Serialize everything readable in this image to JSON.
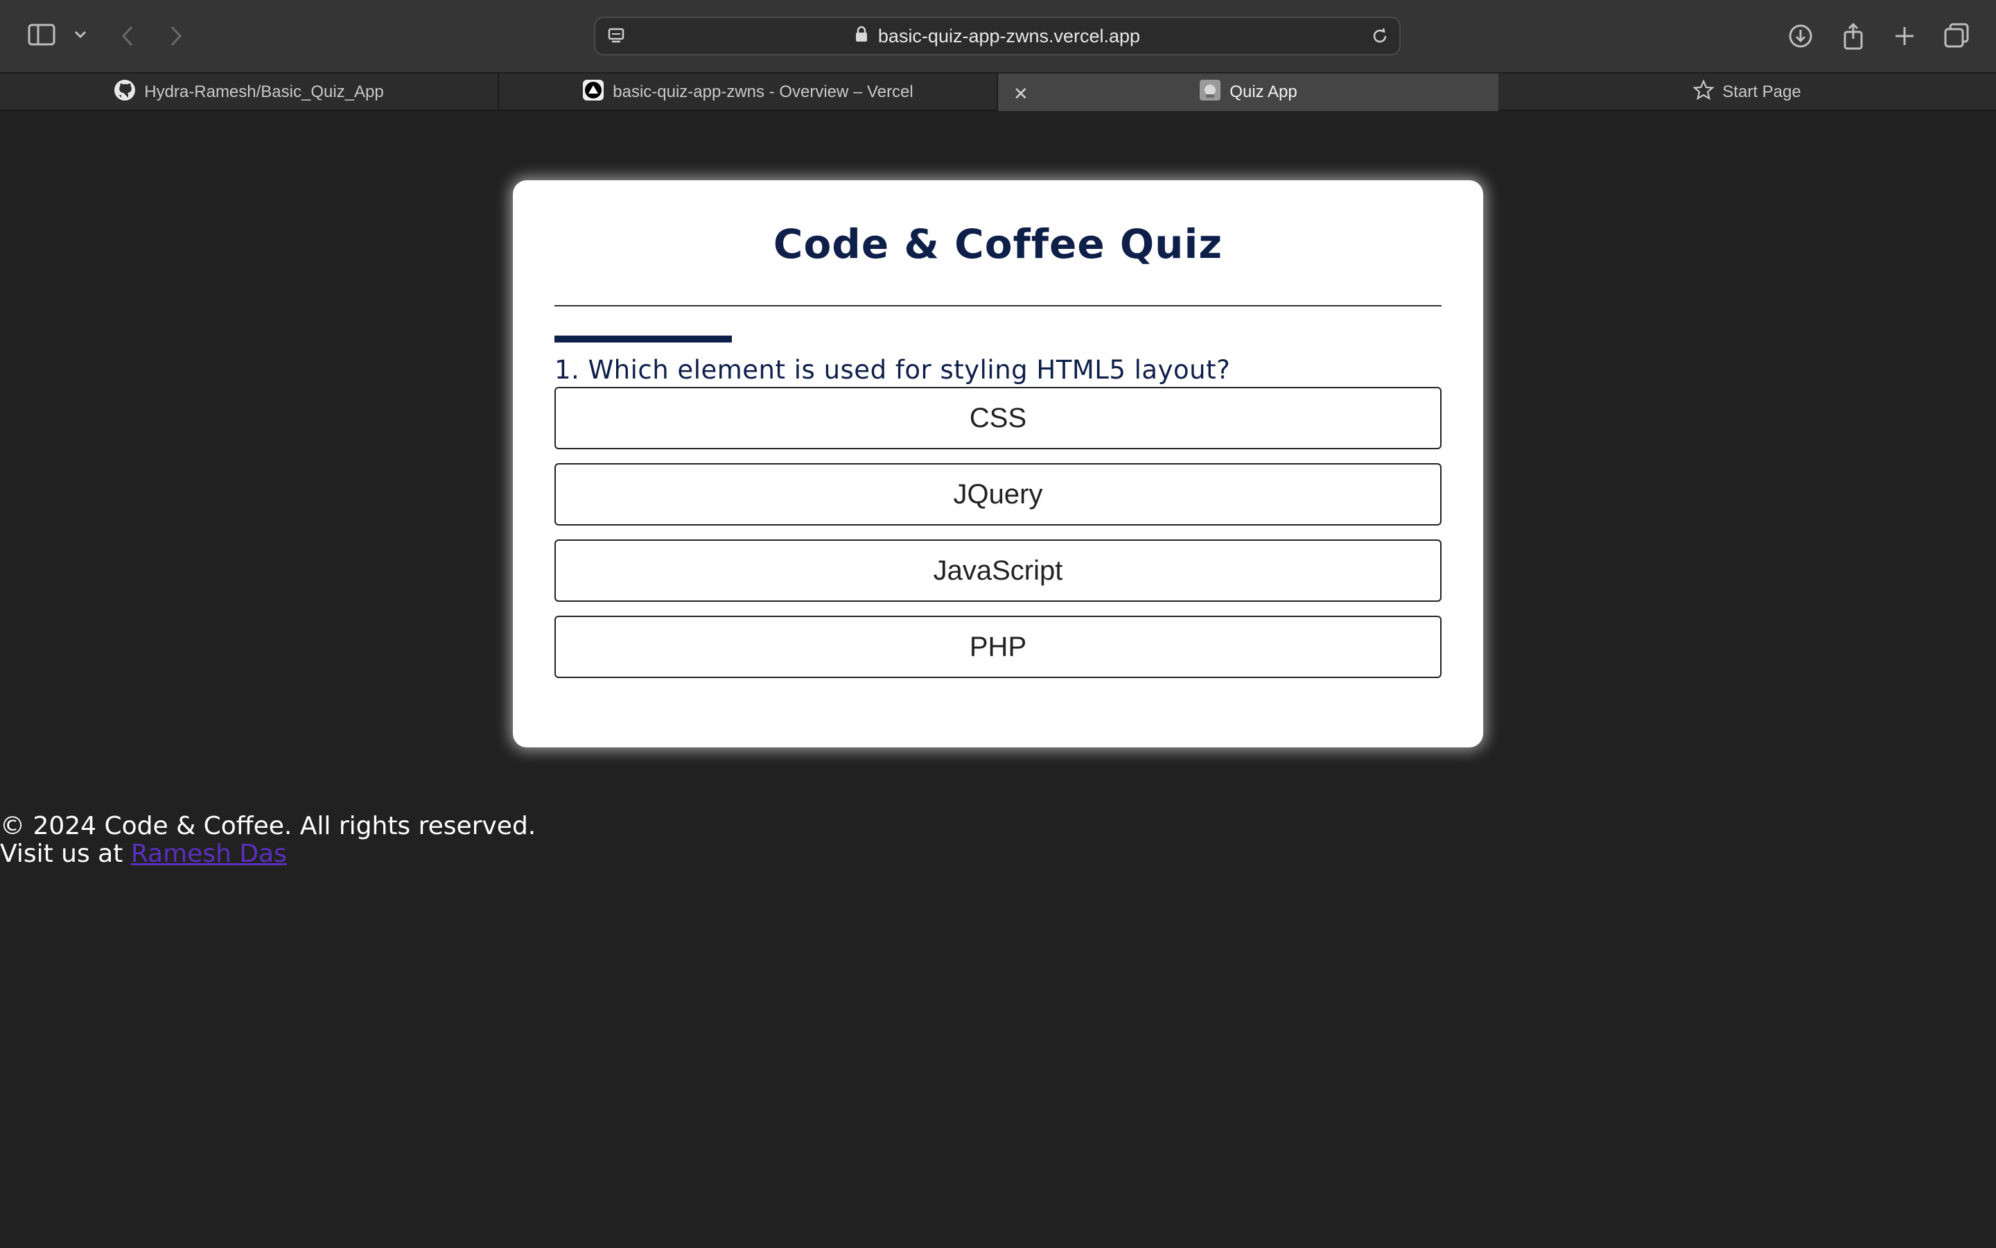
{
  "browser": {
    "url": "basic-quiz-app-zwns.vercel.app",
    "tabs": [
      {
        "label": "Hydra-Ramesh/Basic_Quiz_App",
        "icon": "github-icon"
      },
      {
        "label": "basic-quiz-app-zwns - Overview – Vercel",
        "icon": "vercel-icon"
      },
      {
        "label": "Quiz App",
        "icon": "quiz-favicon",
        "active": true
      },
      {
        "label": "Start Page",
        "icon": "star-icon"
      }
    ]
  },
  "quiz": {
    "title": "Code & Coffee Quiz",
    "progress_fraction": 0.2,
    "question": "1. Which element is used for styling HTML5 layout?",
    "answers": [
      "CSS",
      "JQuery",
      "JavaScript",
      "PHP"
    ]
  },
  "footer": {
    "copyright": "© 2024 Code & Coffee. All rights reserved.",
    "visit_prefix": "Visit us at",
    "link_text": "Ramesh Das"
  },
  "colors": {
    "page_bg": "#212121",
    "accent": "#0e1f4a",
    "link": "#5b2fbf"
  }
}
